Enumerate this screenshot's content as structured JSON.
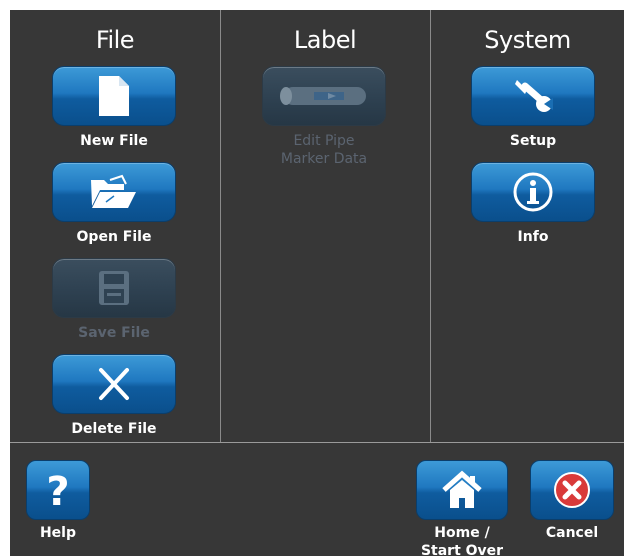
{
  "columns": {
    "file": {
      "title": "File"
    },
    "label": {
      "title": "Label"
    },
    "system": {
      "title": "System"
    }
  },
  "file_buttons": {
    "new_file": "New File",
    "open_file": "Open File",
    "save_file": "Save File",
    "delete_file": "Delete File"
  },
  "label_buttons": {
    "edit_pipe_line1": "Edit Pipe",
    "edit_pipe_line2": "Marker Data"
  },
  "system_buttons": {
    "setup": "Setup",
    "info": "Info"
  },
  "bottom_bar": {
    "help": "Help",
    "home_line1": "Home /",
    "home_line2": "Start Over",
    "cancel": "Cancel"
  },
  "states": {
    "save_file": "disabled",
    "edit_pipe_marker_data": "disabled"
  },
  "colors": {
    "panel_bg": "#373737",
    "button_blue": "#1f78c0",
    "disabled_button": "#2f4252",
    "cancel_red": "#d93a3a"
  },
  "icons": {
    "new_file": "document-icon",
    "open_file": "open-folder-icon",
    "save_file": "floppy-disk-icon",
    "delete_file": "x-icon",
    "edit_pipe": "pipe-icon",
    "setup": "wrench-icon",
    "info": "info-icon",
    "help": "question-mark-icon",
    "home": "home-icon",
    "cancel": "cancel-icon"
  }
}
